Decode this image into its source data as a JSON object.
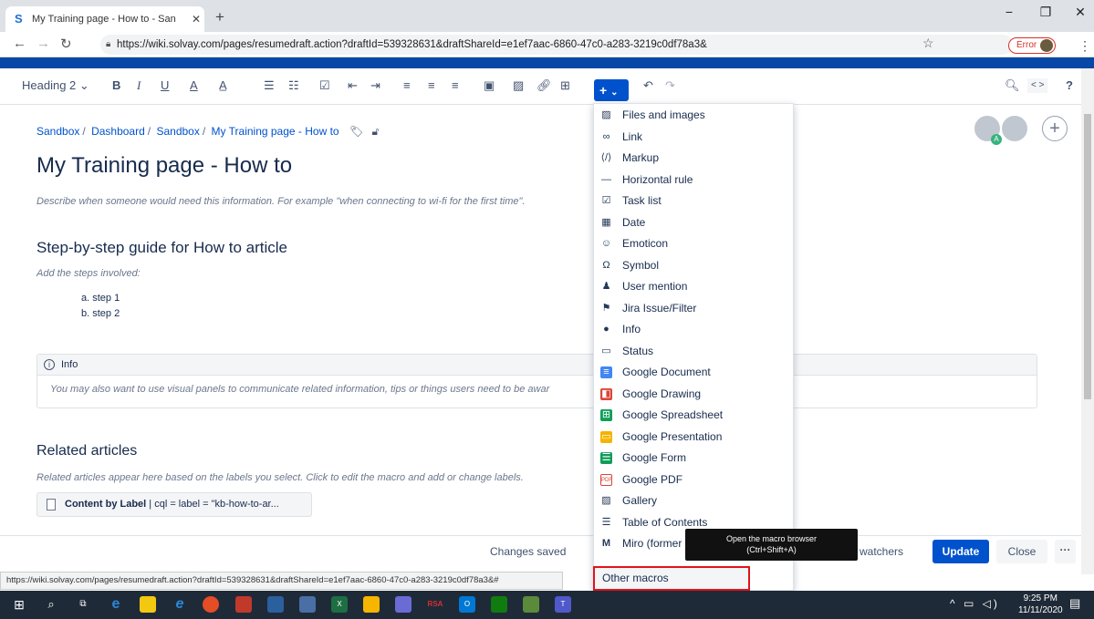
{
  "browser": {
    "tab_title": "My Training page - How to - San",
    "tab_close": "✕",
    "new_tab": "+",
    "url": "https://wiki.solvay.com/pages/resumedraft.action?draftId=539328631&draftShareId=e1ef7aac-6860-47c0-a283-3219c0df78a3&",
    "error_label": "Error",
    "minimize": "−",
    "restore": "❐",
    "close": "✕"
  },
  "toolbar": {
    "heading_style": "Heading 2",
    "bold": "B",
    "italic": "I",
    "underline": "U",
    "text_color": "A",
    "insert_plus": "+"
  },
  "page": {
    "breadcrumb": [
      "Sandbox",
      "Dashboard",
      "Sandbox",
      "My Training page - How to"
    ],
    "title": "My Training page - How to",
    "intro": "Describe when someone would need this information. For example \"when connecting to wi-fi for the first time\".",
    "step_heading": "Step-by-step guide for How to article",
    "steps_hint": "Add the steps involved:",
    "steps": [
      "a. step 1",
      "b. step 2"
    ],
    "info_title": "Info",
    "info_body": "You may also want to use visual panels to communicate related information, tips or things users need to be awar",
    "related_heading": "Related articles",
    "related_hint": "Related articles appear here based on the labels you select. Click to edit the macro and add or change labels.",
    "content_by_label_bold": "Content by Label",
    "content_by_label_rest": " | cql = label = \"kb-how-to-ar..."
  },
  "footer": {
    "status": "Changes saved",
    "watchers": "watchers",
    "update": "Update",
    "close": "Close",
    "more": "···"
  },
  "insert_menu": {
    "items": [
      {
        "label": "Files and images",
        "icon": "image-icon"
      },
      {
        "label": "Link",
        "icon": "link-icon"
      },
      {
        "label": "Markup",
        "icon": "code-icon"
      },
      {
        "label": "Horizontal rule",
        "icon": "rule-icon"
      },
      {
        "label": "Task list",
        "icon": "checkbox-icon"
      },
      {
        "label": "Date",
        "icon": "calendar-icon"
      },
      {
        "label": "Emoticon",
        "icon": "smile-icon"
      },
      {
        "label": "Symbol",
        "icon": "omega-icon"
      },
      {
        "label": "User mention",
        "icon": "user-icon"
      },
      {
        "label": "Jira Issue/Filter",
        "icon": "jira-icon"
      },
      {
        "label": "Info",
        "icon": "info-icon"
      },
      {
        "label": "Status",
        "icon": "status-icon"
      },
      {
        "label": "Google Document",
        "icon": "google-doc-icon"
      },
      {
        "label": "Google Drawing",
        "icon": "google-drawing-icon"
      },
      {
        "label": "Google Spreadsheet",
        "icon": "google-sheet-icon"
      },
      {
        "label": "Google Presentation",
        "icon": "google-slides-icon"
      },
      {
        "label": "Google Form",
        "icon": "google-form-icon"
      },
      {
        "label": "Google PDF",
        "icon": "pdf-icon"
      },
      {
        "label": "Gallery",
        "icon": "gallery-icon"
      },
      {
        "label": "Table of Contents",
        "icon": "toc-icon"
      },
      {
        "label": "Miro (former",
        "icon": "miro-icon"
      }
    ],
    "other_macros": "Other macros",
    "tooltip_line1": "Open the macro browser",
    "tooltip_line2": "(Ctrl+Shift+A)"
  },
  "status_url": "https://wiki.solvay.com/pages/resumedraft.action?draftId=539328631&draftShareId=e1ef7aac-6860-47c0-a283-3219c0df78a3&#",
  "taskbar": {
    "time": "9:25 PM",
    "date": "11/11/2020"
  },
  "colors": {
    "accent": "#0052cc",
    "highlight_border": "#e0141a",
    "taskbar": "#1f2a38"
  }
}
